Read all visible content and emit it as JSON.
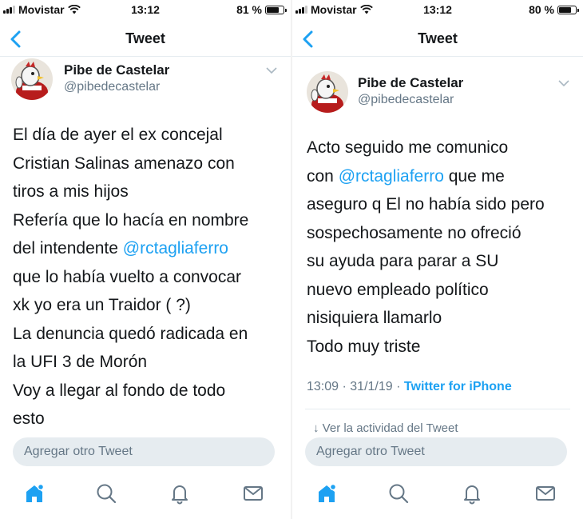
{
  "screens": [
    {
      "status": {
        "carrier": "Movistar",
        "time": "13:12",
        "battery": "81 %",
        "battery_level": 0.81
      },
      "nav": {
        "title": "Tweet"
      },
      "tweet": {
        "name": "Pibe de Castelar",
        "handle": "@pibedecastelar",
        "lines": [
          "El día de ayer el ex concejal",
          "Cristian Salinas amenazo con",
          "tiros a mis hijos",
          "Refería que lo hacía en nombre",
          [
            "del intendente ",
            "@rctagliaferro"
          ],
          "que lo había vuelto a convocar",
          "xk yo era un Traidor ( ?)",
          "La denuncia quedó radicada en",
          "la UFI 3 de Morón",
          "Voy a llegar al fondo de todo",
          "esto"
        ]
      },
      "compose": {
        "placeholder": "Agregar otro Tweet"
      },
      "tabs": [
        "home-icon",
        "search-icon",
        "notifications-icon",
        "messages-icon"
      ]
    },
    {
      "status": {
        "carrier": "Movistar",
        "time": "13:12",
        "battery": "80 %",
        "battery_level": 0.8
      },
      "nav": {
        "title": "Tweet"
      },
      "tweet": {
        "name": "Pibe de Castelar",
        "handle": "@pibedecastelar",
        "lines": [
          "Acto seguido me comunico",
          [
            "con ",
            "@rctagliaferro",
            " que me"
          ],
          "aseguro q El no había sido pero",
          "sospechosamente no ofreció",
          "su ayuda para parar a SU",
          "nuevo empleado político",
          "nisiquiera llamarlo",
          "Todo muy triste"
        ],
        "time": "13:09",
        "date": "31/1/19",
        "client": "Twitter for iPhone",
        "activity": "Ver la actividad del Tweet"
      },
      "compose": {
        "placeholder": "Agregar otro Tweet"
      },
      "tabs": [
        "home-icon",
        "search-icon",
        "notifications-icon",
        "messages-icon"
      ]
    }
  ],
  "colors": {
    "accent": "#1da1f2",
    "text": "#14171a",
    "secondary": "#657786",
    "compose_bg": "#e6ecf0"
  }
}
